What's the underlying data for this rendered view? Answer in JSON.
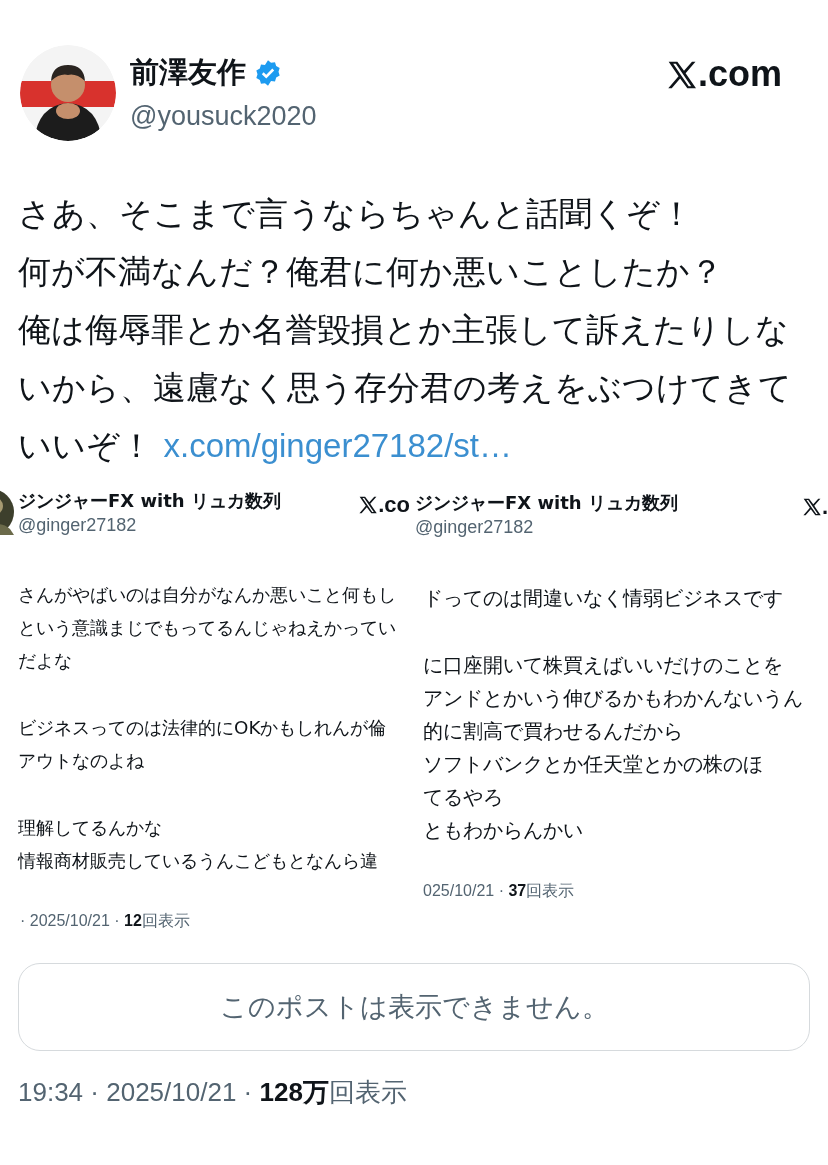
{
  "author": {
    "name": "前澤友作",
    "verified": true,
    "handle": "@yousuck2020"
  },
  "site": {
    "suffix": ".com"
  },
  "tweet": {
    "lines": [
      "さあ、そこまで言うならちゃんと話聞くぞ！",
      "何が不満なんだ？俺君に何か悪いことしたか？",
      "俺は侮辱罪とか名誉毀損とか主張して訴えたりしな",
      "いから、遠慮なく思う存分君の考えをぶつけてきて",
      "いいぞ！"
    ],
    "link": "x.com/ginger27182/st…"
  },
  "attached_images": [
    {
      "name": "ジンジャーFX with リュカ数列",
      "handle": "@ginger27182",
      "site_suffix": ".co",
      "avatar": true,
      "paragraphs": [
        [
          "さんがやばいのは自分がなんか悪いこと何もし",
          "という意識まじでもってるんじゃねえかってい",
          "だよな"
        ],
        [
          "ビジネスってのは法律的にOKかもしれんが倫",
          "アウトなのよね"
        ],
        [
          "理解してるんかな",
          "情報商材販売しているうんこどもとなんら違"
        ]
      ],
      "footer": "· 2025/10/21 ·",
      "views": "12",
      "views_suffix": "回表示"
    },
    {
      "name": "ジンジャーFX with リュカ数列",
      "handle": "@ginger27182",
      "site_suffix": ".",
      "avatar": false,
      "paragraphs": [
        [
          "ドってのは間違いなく情弱ビジネスです"
        ],
        [
          "に口座開いて株買えばいいだけのことを",
          "アンドとかいう伸びるかもわかんないうん",
          "的に割高で買わせるんだから",
          "ソフトバンクとか任天堂とかの株のほ",
          "てるやろ",
          "ともわからんかい"
        ]
      ],
      "footer": "025/10/21 ·",
      "views": "37",
      "views_suffix": "回表示"
    }
  ],
  "unavailable_notice": "このポストは表示できません。",
  "meta": {
    "time": "19:34",
    "separator": "·",
    "date": "2025/10/21",
    "views": "128万",
    "views_suffix": "回表示"
  }
}
